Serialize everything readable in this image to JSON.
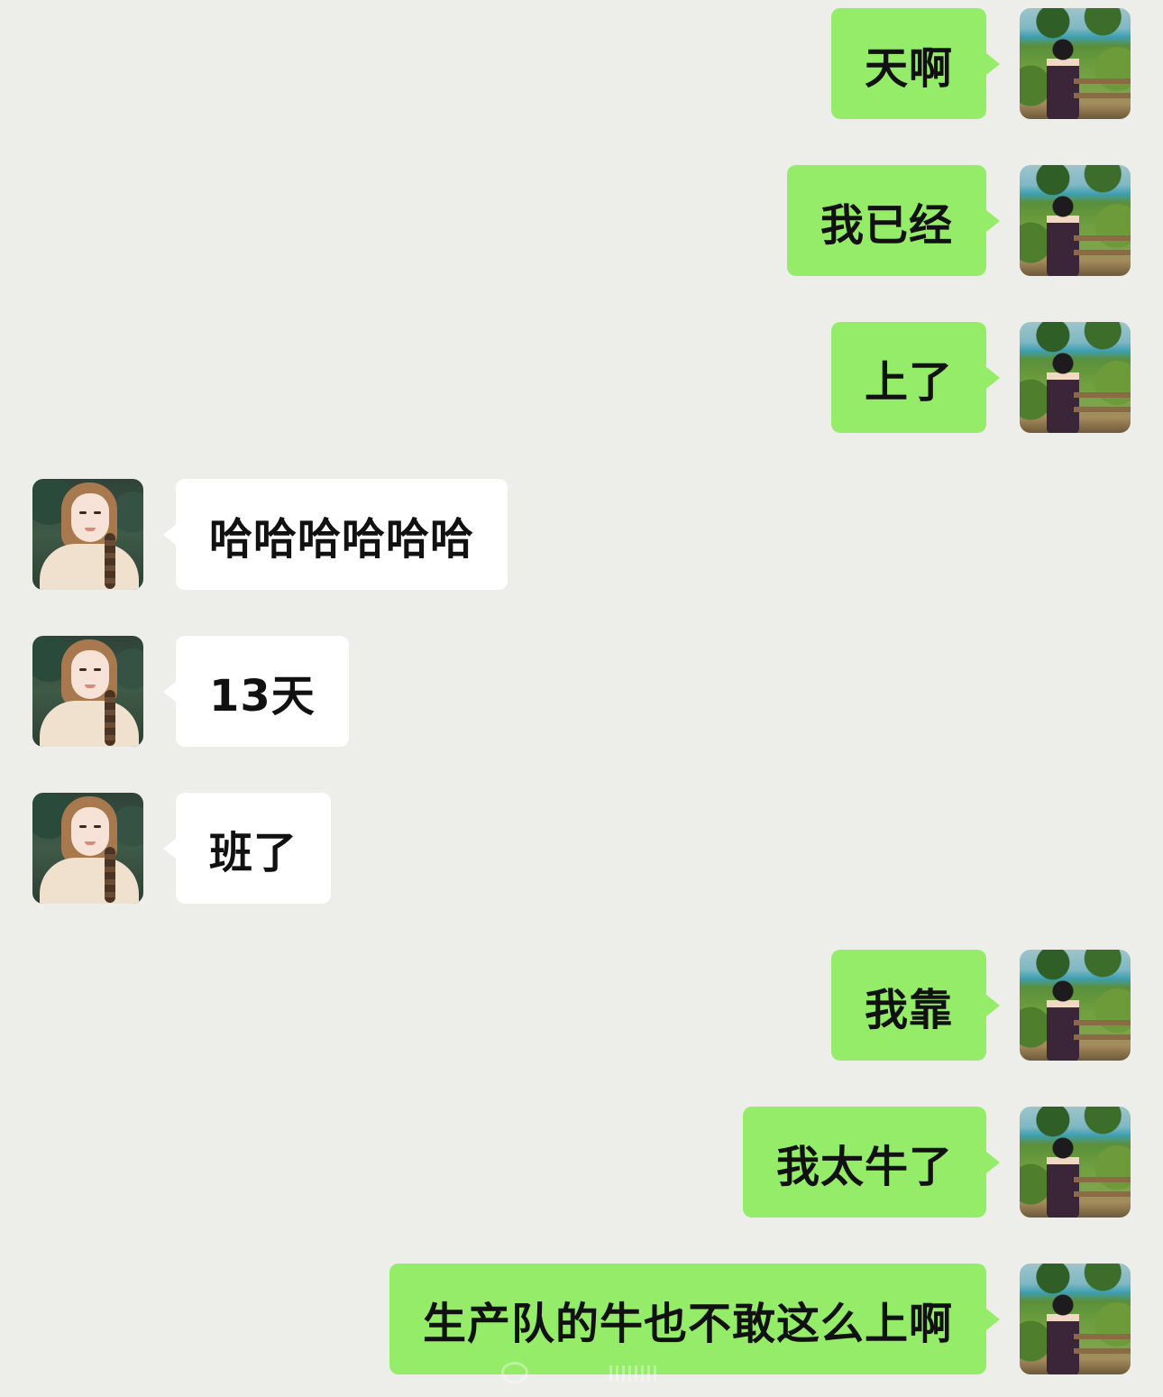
{
  "conversation": {
    "messages": [
      {
        "side": "right",
        "text": "天啊"
      },
      {
        "side": "right",
        "text": "我已经"
      },
      {
        "side": "right",
        "text": "上了"
      },
      {
        "side": "left",
        "text": "哈哈哈哈哈哈"
      },
      {
        "side": "left",
        "text": "13天"
      },
      {
        "side": "left",
        "text": "班了"
      },
      {
        "side": "right",
        "text": "我靠"
      },
      {
        "side": "right",
        "text": "我太牛了"
      },
      {
        "side": "right",
        "text": "生产队的牛也不敢这么上啊"
      }
    ]
  },
  "colors": {
    "background": "#ededea",
    "sent_bubble": "#95ec69",
    "received_bubble": "#ffffff",
    "text": "#111111"
  }
}
